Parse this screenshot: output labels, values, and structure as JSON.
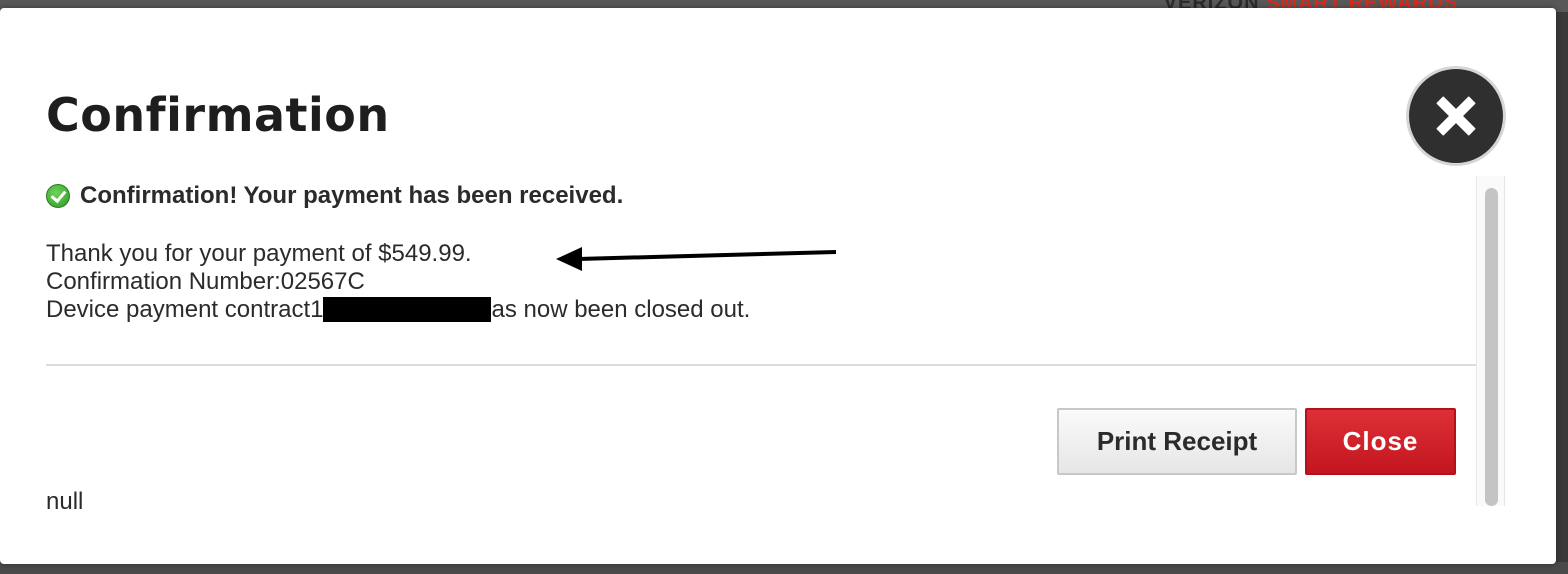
{
  "background": {
    "brand_text": "VERIZON",
    "brand_accent": "SMART REWARDS"
  },
  "modal": {
    "title": "Confirmation",
    "close_icon": "close-x-icon",
    "status_icon": "check-circle-icon",
    "status_message": "Confirmation! Your payment has been received.",
    "details": {
      "payment_line": "Thank you for your payment of $549.99.",
      "confirmation_line": "Confirmation Number:02567C",
      "contract_prefix": "Device payment contract",
      "contract_visible_char": "1",
      "contract_suffix": "as now been closed out."
    },
    "buttons": {
      "print_receipt": "Print Receipt",
      "close": "Close"
    },
    "footer_text": "null"
  },
  "colors": {
    "close_button": "#c4161f",
    "success": "#2f9a2a",
    "close_x_bg": "#2f2f2f"
  }
}
